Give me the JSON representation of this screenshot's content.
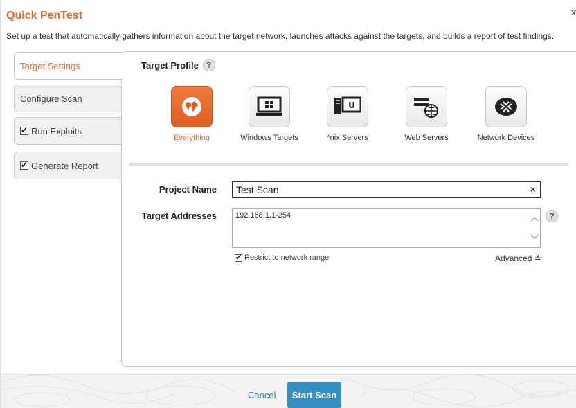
{
  "dialog": {
    "title": "Quick PenTest",
    "close": "x",
    "subtitle": "Set up a test that automatically gathers information about the target network, launches attacks against the targets, and builds a report of test findings."
  },
  "tabs": [
    {
      "label": "Target Settings",
      "active": true
    },
    {
      "label": "Configure Scan",
      "active": false
    },
    {
      "label": "Run Exploits",
      "checked": true
    },
    {
      "label": "Generate Report",
      "checked": true
    }
  ],
  "target_profile": {
    "label": "Target Profile",
    "help": "?",
    "profiles": [
      {
        "label": "Everything",
        "icon": "globe-icon",
        "selected": true
      },
      {
        "label": "Windows Targets",
        "icon": "windows-monitor-icon"
      },
      {
        "label": "*nix Servers",
        "icon": "unix-server-icon"
      },
      {
        "label": "Web Servers",
        "icon": "web-server-icon"
      },
      {
        "label": "Network Devices",
        "icon": "router-icon"
      }
    ]
  },
  "form": {
    "project_name_label": "Project Name",
    "project_name_value": "Test Scan",
    "clear": "×",
    "target_addresses_label": "Target Addresses",
    "target_addresses_value": "192.168.1.1-254",
    "help": "?",
    "restrict_label": "Restrict to network range",
    "advanced_label": "Advanced ≚"
  },
  "footer": {
    "cancel": "Cancel",
    "start": "Start Scan"
  },
  "colors": {
    "accent": "#e8692d",
    "button": "#3590c2",
    "link": "#2a86b8"
  }
}
